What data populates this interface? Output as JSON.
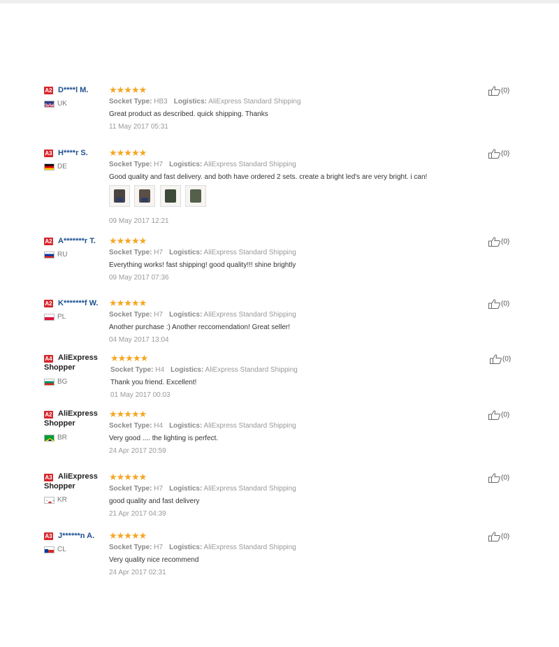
{
  "reviews": [
    {
      "badge": "A2",
      "name": "D****l M.",
      "country": "UK",
      "flag": "uk",
      "socket_label": "Socket Type:",
      "socket": "HB3",
      "logistics_label": "Logistics:",
      "logistics": "AliExpress Standard Shipping",
      "text": "Great product as described. quick shipping. Thanks",
      "date": "11 May 2017 05:31",
      "likes": "(0)"
    },
    {
      "badge": "A3",
      "name": "H****r S.",
      "country": "DE",
      "flag": "de",
      "socket_label": "Socket Type:",
      "socket": "H7",
      "logistics_label": "Logistics:",
      "logistics": "AliExpress Standard Shipping",
      "text": "Good quality and fast delivery. and both have ordered 2 sets. create a bright led's are very bright. i can!",
      "date": "09 May 2017 12:21",
      "likes": "(0)",
      "photos": 4
    },
    {
      "badge": "A2",
      "name": "A*******r T.",
      "country": "RU",
      "flag": "ru",
      "socket_label": "Socket Type:",
      "socket": "H7",
      "logistics_label": "Logistics:",
      "logistics": "AliExpress Standard Shipping",
      "text": "Everything works! fast shipping! good quality!!! shine brightly",
      "date": "09 May 2017 07:36",
      "likes": "(0)"
    },
    {
      "badge": "A2",
      "name": "K*******f W.",
      "country": "PL",
      "flag": "pl",
      "socket_label": "Socket Type:",
      "socket": "H7",
      "logistics_label": "Logistics:",
      "logistics": "AliExpress Standard Shipping",
      "text": "Another purchase :) Another reccomendation! Great seller!",
      "date": "04 May 2017 13:04",
      "likes": "(0)"
    },
    {
      "badge": "A4",
      "name": "AliExpress Shopper",
      "country": "BG",
      "flag": "bg",
      "socket_label": "Socket Type:",
      "socket": "H4",
      "logistics_label": "Logistics:",
      "logistics": "AliExpress Standard Shipping",
      "text": "Thank you friend. Excellent!",
      "date": "01 May 2017 00:03",
      "likes": "(0)"
    },
    {
      "badge": "A2",
      "name": "AliExpress Shopper",
      "country": "BR",
      "flag": "br",
      "socket_label": "Socket Type:",
      "socket": "H4",
      "logistics_label": "Logistics:",
      "logistics": "AliExpress Standard Shipping",
      "text": "Very good .... the lighting is perfect.",
      "date": "24 Apr 2017 20:59",
      "likes": "(0)"
    },
    {
      "badge": "A3",
      "name": "AliExpress Shopper",
      "country": "KR",
      "flag": "kr",
      "socket_label": "Socket Type:",
      "socket": "H7",
      "logistics_label": "Logistics:",
      "logistics": "AliExpress Standard Shipping",
      "text": "good quality and fast delivery",
      "date": "21 Apr 2017 04:39",
      "likes": "(0)"
    },
    {
      "badge": "A3",
      "name": "J******n A.",
      "country": "CL",
      "flag": "cl",
      "socket_label": "Socket Type:",
      "socket": "H7",
      "logistics_label": "Logistics:",
      "logistics": "AliExpress Standard Shipping",
      "text": "Very quality nice recommend",
      "date": "24 Apr 2017 02:31",
      "likes": "(0)"
    }
  ],
  "rating_stars": "★★★★★",
  "icons": {
    "like": "thumbs-up-icon",
    "star": "star-icon"
  },
  "colors": {
    "star": "#f5a623",
    "badge": "#d6262c",
    "name": "#1d4f91"
  }
}
